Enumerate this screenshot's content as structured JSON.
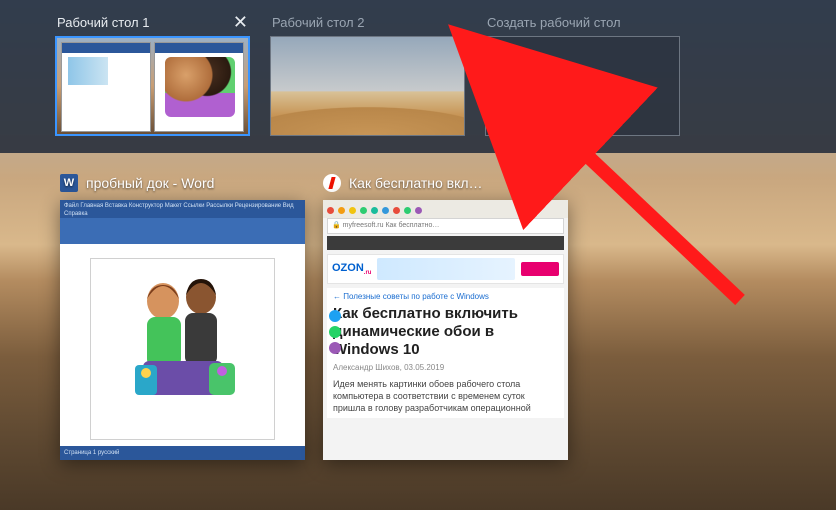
{
  "desktops": {
    "d1": {
      "label": "Рабочий стол 1"
    },
    "d2": {
      "label": "Рабочий стол 2"
    },
    "new": {
      "label": "Создать рабочий стол"
    }
  },
  "windows": {
    "word": {
      "title": "пробный док - Word",
      "ribbon_line1": "Файл  Главная  Вставка  Конструктор  Макет  Ссылки  Рассылки  Рецензирование  Вид  Справка",
      "status": "Страница 1    русский"
    },
    "browser": {
      "title": "Как бесплатно вкл…",
      "addr": "myfreesoft.ru  Как бесплатно…",
      "ozon_logo": "OZON",
      "ozon_sub": ".ru",
      "crumb": "Полезные советы по работе с Windows",
      "h1": "Как бесплатно включить динамические обои в Windows 10",
      "meta": "Александр Шихов, 03.05.2019",
      "para": "Идея менять картинки обоев рабочего стола компьютера в соответствии с временем суток пришла в голову разработчикам операционной"
    }
  },
  "tab_colors": [
    "#e74c3c",
    "#f39c12",
    "#f1c40f",
    "#2ecc71",
    "#1abc9c",
    "#3498db",
    "#e74c3c",
    "#2ecc71",
    "#9b59b6"
  ],
  "icons": {
    "close": "✕",
    "plus": "＋",
    "word": "W"
  }
}
